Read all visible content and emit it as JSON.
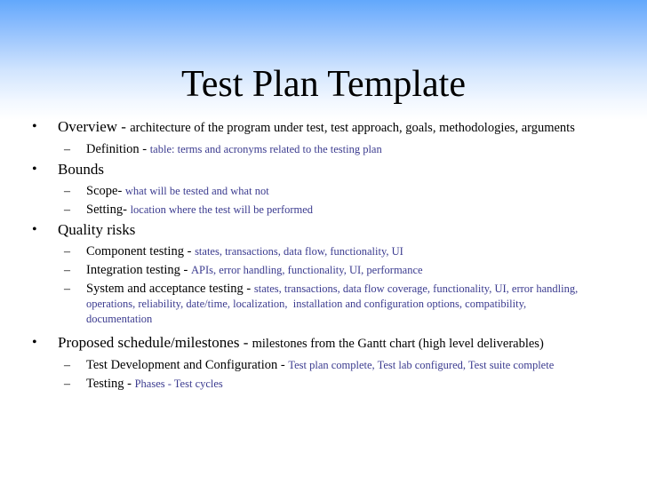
{
  "slide": {
    "title": "Test Plan Template",
    "colors": {
      "header_gradient_top": "#62a8fc",
      "header_gradient_bottom": "#ffffff",
      "primary_text": "#000000",
      "description_text": "#3b3b8f"
    },
    "bullet_glyph": "•",
    "dash_glyph": "–",
    "items": [
      {
        "label": "Overview",
        "separator": " - ",
        "description": "architecture of the program under test, test approach, goals, methodologies, arguments",
        "subitems": [
          {
            "label": "Definition",
            "separator": " - ",
            "description": "table: terms and acronyms related to the testing plan"
          }
        ]
      },
      {
        "label": "Bounds",
        "separator": "",
        "description": "",
        "subitems": [
          {
            "label": "Scope",
            "separator": "- ",
            "description": "what will be tested and what not"
          },
          {
            "label": "Setting",
            "separator": "- ",
            "description": "location where the test will be performed"
          }
        ]
      },
      {
        "label": "Quality risks",
        "separator": "",
        "description": "",
        "subitems": [
          {
            "label": "Component testing",
            "separator": " - ",
            "description": "states, transactions, data flow, functionality, UI"
          },
          {
            "label": "Integration testing",
            "separator": " - ",
            "description": "APIs, error handling, functionality, UI, performance"
          },
          {
            "label": "System and acceptance testing",
            "separator": " - ",
            "description": "states, transactions, data flow coverage, functionality, UI, error handling, operations, reliability, date/time, localization,  installation and configuration options, compatibility, documentation"
          }
        ]
      },
      {
        "label": "Proposed schedule/milestones",
        "separator": " - ",
        "description": "milestones from the Gantt chart (high level deliverables)",
        "subitems": [
          {
            "label": "Test Development and Configuration",
            "separator": " - ",
            "description": "Test plan complete, Test lab configured, Test suite complete"
          },
          {
            "label": "Testing",
            "separator": " - ",
            "description": "Phases - Test cycles"
          }
        ]
      }
    ]
  }
}
